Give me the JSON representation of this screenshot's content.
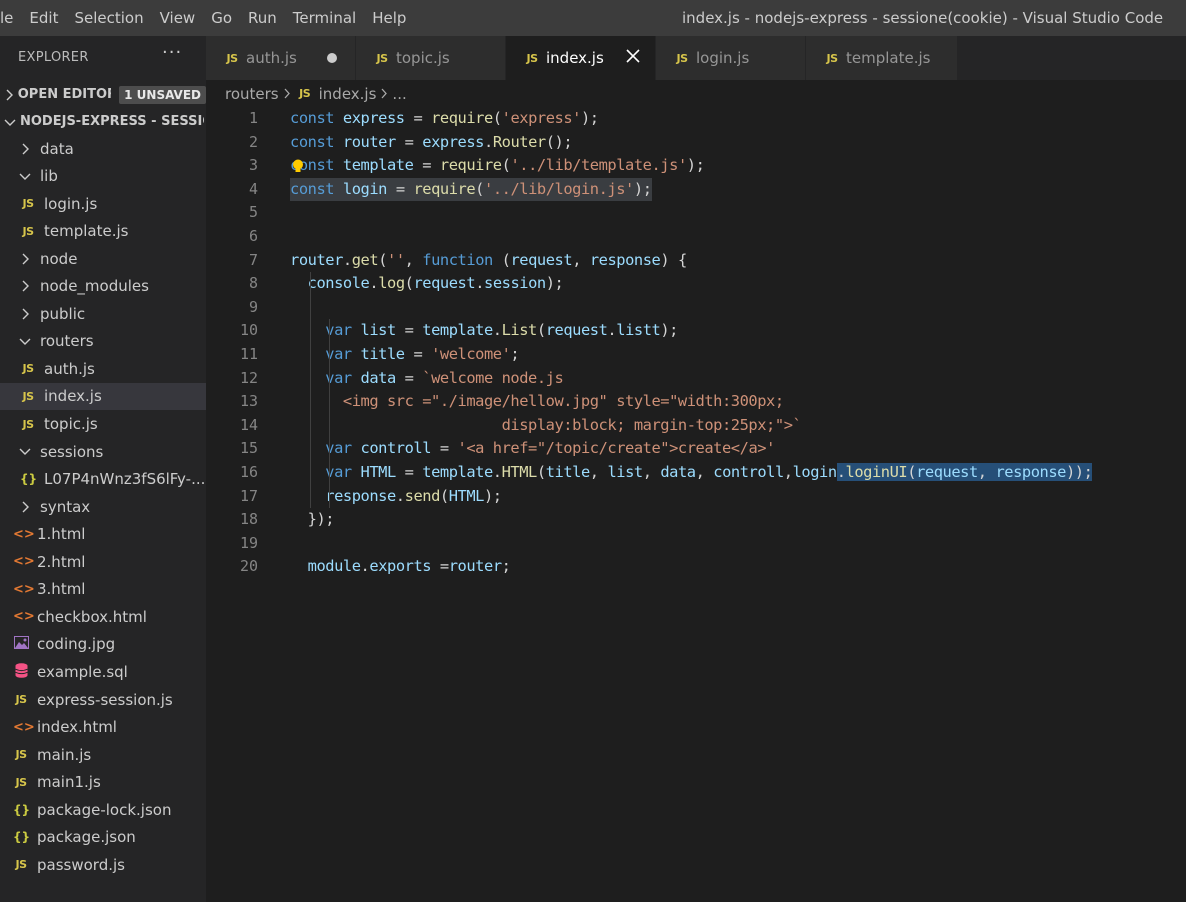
{
  "menubar": {
    "items": [
      "le",
      "Edit",
      "Selection",
      "View",
      "Go",
      "Run",
      "Terminal",
      "Help"
    ]
  },
  "window_title": "index.js - nodejs-express - sessione(cookie) - Visual Studio Code",
  "explorer": {
    "title": "EXPLORER",
    "more": "···",
    "open_editors": {
      "label": "OPEN EDITORS",
      "badge": "1 UNSAVED"
    },
    "project": {
      "label": "NODEJS-EXPRESS - SESSIO..."
    },
    "tree": [
      {
        "label": "data",
        "type": "folder",
        "expanded": false,
        "depth": 1
      },
      {
        "label": "lib",
        "type": "folder",
        "expanded": true,
        "depth": 1
      },
      {
        "label": "login.js",
        "type": "js",
        "depth": 2
      },
      {
        "label": "template.js",
        "type": "js",
        "depth": 2
      },
      {
        "label": "node",
        "type": "folder",
        "expanded": false,
        "depth": 1
      },
      {
        "label": "node_modules",
        "type": "folder",
        "expanded": false,
        "depth": 1
      },
      {
        "label": "public",
        "type": "folder",
        "expanded": false,
        "depth": 1
      },
      {
        "label": "routers",
        "type": "folder",
        "expanded": true,
        "depth": 1
      },
      {
        "label": "auth.js",
        "type": "js",
        "depth": 2
      },
      {
        "label": "index.js",
        "type": "js",
        "depth": 2,
        "selected": true
      },
      {
        "label": "topic.js",
        "type": "js",
        "depth": 2
      },
      {
        "label": "sessions",
        "type": "folder",
        "expanded": true,
        "depth": 1
      },
      {
        "label": "L07P4nWnz3fS6lFy-...",
        "type": "json",
        "depth": 2
      },
      {
        "label": "syntax",
        "type": "folder",
        "expanded": false,
        "depth": 1
      },
      {
        "label": "1.html",
        "type": "html",
        "depth": 1
      },
      {
        "label": "2.html",
        "type": "html",
        "depth": 1
      },
      {
        "label": "3.html",
        "type": "html",
        "depth": 1
      },
      {
        "label": "checkbox.html",
        "type": "html",
        "depth": 1
      },
      {
        "label": "coding.jpg",
        "type": "image",
        "depth": 1
      },
      {
        "label": "example.sql",
        "type": "sql",
        "depth": 1
      },
      {
        "label": "express-session.js",
        "type": "js",
        "depth": 1
      },
      {
        "label": "index.html",
        "type": "html",
        "depth": 1
      },
      {
        "label": "main.js",
        "type": "js",
        "depth": 1
      },
      {
        "label": "main1.js",
        "type": "js",
        "depth": 1
      },
      {
        "label": "package-lock.json",
        "type": "json",
        "depth": 1
      },
      {
        "label": "package.json",
        "type": "json",
        "depth": 1
      },
      {
        "label": "password.js",
        "type": "js",
        "depth": 1
      }
    ]
  },
  "tabs": [
    {
      "label": "auth.js",
      "state": "dirty"
    },
    {
      "label": "topic.js",
      "state": "normal"
    },
    {
      "label": "index.js",
      "state": "active"
    },
    {
      "label": "login.js",
      "state": "normal"
    },
    {
      "label": "template.js",
      "state": "normal"
    }
  ],
  "breadcrumb": {
    "folder": "routers",
    "file": "index.js",
    "tail": "..."
  },
  "icons": {
    "js_label": "JS",
    "html_glyph": "<>",
    "json_glyph": "{}"
  },
  "colors": {
    "keyword": "#569cd6",
    "variable": "#9cdcfe",
    "function": "#dcdcaa",
    "string": "#ce9178",
    "js_icon": "#d7c54b",
    "html_icon": "#e37933"
  },
  "editor": {
    "line_numbers": [
      "1",
      "2",
      "3",
      "4",
      "5",
      "6",
      "7",
      "8",
      "9",
      "10",
      "11",
      "12",
      "13",
      "14",
      "15",
      "16",
      "17",
      "18",
      "19",
      "20"
    ],
    "lines": [
      [
        [
          "kw",
          "const "
        ],
        [
          "var",
          "express"
        ],
        [
          "punc",
          " = "
        ],
        [
          "fn",
          "require"
        ],
        [
          "punc",
          "("
        ],
        [
          "str",
          "'express'"
        ],
        [
          "punc",
          ");"
        ]
      ],
      [
        [
          "kw",
          "const "
        ],
        [
          "var",
          "router"
        ],
        [
          "punc",
          " = "
        ],
        [
          "var",
          "express"
        ],
        [
          "punc",
          "."
        ],
        [
          "fn",
          "Router"
        ],
        [
          "punc",
          "();"
        ]
      ],
      [
        [
          "kw",
          "const "
        ],
        [
          "var",
          "template"
        ],
        [
          "punc",
          " = "
        ],
        [
          "fn",
          "require"
        ],
        [
          "punc",
          "("
        ],
        [
          "str",
          "'../lib/template.js'"
        ],
        [
          "punc",
          ");"
        ]
      ],
      [
        [
          "kw",
          "const "
        ],
        [
          "var",
          "login"
        ],
        [
          "punc",
          " = "
        ],
        [
          "fn",
          "require"
        ],
        [
          "punc",
          "("
        ],
        [
          "str",
          "'../lib/login.js'"
        ],
        [
          "punc",
          ");"
        ]
      ],
      [],
      [],
      [
        [
          "var",
          "router"
        ],
        [
          "punc",
          "."
        ],
        [
          "fn",
          "get"
        ],
        [
          "punc",
          "("
        ],
        [
          "str",
          "''"
        ],
        [
          "punc",
          ", "
        ],
        [
          "kw",
          "function "
        ],
        [
          "punc",
          "("
        ],
        [
          "var",
          "request"
        ],
        [
          "punc",
          ", "
        ],
        [
          "var",
          "response"
        ],
        [
          "punc",
          ") {"
        ]
      ],
      [
        [
          "punc",
          "  "
        ],
        [
          "var",
          "console"
        ],
        [
          "punc",
          "."
        ],
        [
          "fn",
          "log"
        ],
        [
          "punc",
          "("
        ],
        [
          "var",
          "request"
        ],
        [
          "punc",
          "."
        ],
        [
          "var",
          "session"
        ],
        [
          "punc",
          ");"
        ]
      ],
      [],
      [
        [
          "punc",
          "    "
        ],
        [
          "kw",
          "var "
        ],
        [
          "var",
          "list"
        ],
        [
          "punc",
          " = "
        ],
        [
          "var",
          "template"
        ],
        [
          "punc",
          "."
        ],
        [
          "fn",
          "List"
        ],
        [
          "punc",
          "("
        ],
        [
          "var",
          "request"
        ],
        [
          "punc",
          "."
        ],
        [
          "var",
          "listt"
        ],
        [
          "punc",
          ");"
        ]
      ],
      [
        [
          "punc",
          "    "
        ],
        [
          "kw",
          "var "
        ],
        [
          "var",
          "title"
        ],
        [
          "punc",
          " = "
        ],
        [
          "str",
          "'welcome'"
        ],
        [
          "punc",
          ";"
        ]
      ],
      [
        [
          "punc",
          "    "
        ],
        [
          "kw",
          "var "
        ],
        [
          "var",
          "data"
        ],
        [
          "punc",
          " = "
        ],
        [
          "str",
          "`welcome node.js"
        ]
      ],
      [
        [
          "str",
          "      <img src =\"./image/hellow.jpg\" style=\"width:300px;"
        ]
      ],
      [
        [
          "str",
          "                        display:block; margin-top:25px;\">`"
        ]
      ],
      [
        [
          "punc",
          "    "
        ],
        [
          "kw",
          "var "
        ],
        [
          "var",
          "controll"
        ],
        [
          "punc",
          " = "
        ],
        [
          "str",
          "'<a href=\"/topic/create\">create</a>'"
        ]
      ],
      [
        [
          "punc",
          "    "
        ],
        [
          "kw",
          "var "
        ],
        [
          "var",
          "HTML"
        ],
        [
          "punc",
          " = "
        ],
        [
          "var",
          "template"
        ],
        [
          "punc",
          "."
        ],
        [
          "fn",
          "HTML"
        ],
        [
          "punc",
          "("
        ],
        [
          "var",
          "title"
        ],
        [
          "punc",
          ", "
        ],
        [
          "var",
          "list"
        ],
        [
          "punc",
          ", "
        ],
        [
          "var",
          "data"
        ],
        [
          "punc",
          ", "
        ],
        [
          "var",
          "controll"
        ],
        [
          "punc",
          ","
        ],
        [
          "var",
          "login"
        ],
        [
          "punc",
          "."
        ],
        [
          "fn",
          "loginUI"
        ],
        [
          "punc",
          "("
        ],
        [
          "var",
          "request"
        ],
        [
          "punc",
          ", "
        ],
        [
          "var",
          "response"
        ],
        [
          "punc",
          "));"
        ]
      ],
      [
        [
          "punc",
          "    "
        ],
        [
          "var",
          "response"
        ],
        [
          "punc",
          "."
        ],
        [
          "fn",
          "send"
        ],
        [
          "punc",
          "("
        ],
        [
          "var",
          "HTML"
        ],
        [
          "punc",
          ");"
        ]
      ],
      [
        [
          "punc",
          "  });"
        ]
      ],
      [],
      [
        [
          "punc",
          "  "
        ],
        [
          "var",
          "module"
        ],
        [
          "punc",
          "."
        ],
        [
          "var",
          "exports"
        ],
        [
          "punc",
          " ="
        ],
        [
          "var",
          "router"
        ],
        [
          "punc",
          ";"
        ]
      ]
    ]
  }
}
